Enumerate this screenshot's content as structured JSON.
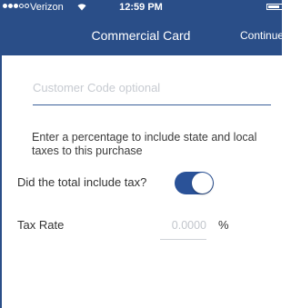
{
  "status_bar": {
    "carrier": "Verizon",
    "time": "12:59 PM",
    "signal_bars_filled": 3,
    "signal_bars_total": 5
  },
  "nav": {
    "title": "Commercial Card",
    "continue_label": "Continue"
  },
  "form": {
    "customer_code_placeholder": "Customer Code optional",
    "tax_info_text": "Enter a percentage to include state and local taxes to this purchase",
    "tax_included_label": "Did the total include tax?",
    "tax_included_value": "on",
    "tax_rate_label": "Tax Rate",
    "tax_rate_placeholder": "0.0000",
    "tax_rate_unit": "%"
  },
  "colors": {
    "navbar": "#2a4e88",
    "toggle_on": "#2a5298"
  },
  "icons": {
    "wifi": "wifi-icon",
    "battery": "battery-icon"
  }
}
